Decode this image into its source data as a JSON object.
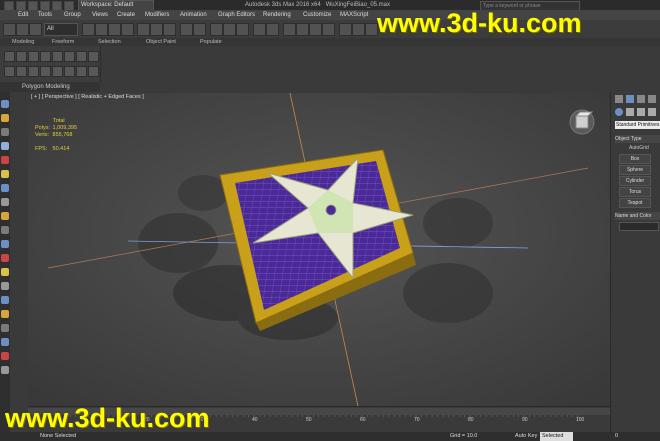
{
  "titlebar": {
    "workspace": "Workspace: Default",
    "app_title": "Autodesk 3ds Max  2016 x64",
    "file_name": "WuXingFeiBiao_05.max",
    "search_placeholder": "Type a keyword or phrase"
  },
  "menu": [
    "Edit",
    "Tools",
    "Group",
    "Views",
    "Create",
    "Modifiers",
    "Animation",
    "Graph Editors",
    "Rendering",
    "Customize",
    "MAXScript"
  ],
  "ribbon": {
    "tabs": [
      "Modeling",
      "Freeform",
      "Selection",
      "Object Paint",
      "Populate"
    ],
    "panel_label": "Polygon Modeling"
  },
  "toolbar": {
    "filter_value": "All"
  },
  "viewport": {
    "label": "[ + ] [ Perspective ] [ Realistic + Edged Faces ]",
    "stats_title": "Total",
    "polys_label": "Polys:",
    "polys_value": "1,009,395",
    "verts_label": "Verts:",
    "verts_value": "855,768",
    "fps_label": "FPS:",
    "fps_value": "50.414"
  },
  "command_panel": {
    "dropdown": "Standard Primitives",
    "rollout_object_type": "Object Type",
    "autogrid": "AutoGrid",
    "buttons": [
      "Box",
      "Sphere",
      "Cylinder",
      "Torus",
      "Teapot"
    ],
    "rollout_name_color": "Name and Color"
  },
  "timeline": {
    "ticks": [
      "0",
      "10",
      "20",
      "30",
      "40",
      "50",
      "60",
      "70",
      "80",
      "90",
      "100"
    ]
  },
  "status": {
    "selection": "None Selected",
    "grid": "Grid = 10.0",
    "autokey": "Auto Key",
    "set_mode": "Selected",
    "frame": "0"
  },
  "watermarks": {
    "top": "www.3d-ku.com",
    "bottom": "www.3d-ku.com"
  },
  "colors": {
    "viewport_bg": "#4a4a4a",
    "stats_yellow": "#e2cf3f",
    "platform_yellow": "#c9a01a",
    "platform_purple": "#4b2a97",
    "shuriken": "#e6e6d2",
    "watermark": "#ffff00"
  },
  "icons": [
    "viewcube-icon",
    "create-icon",
    "modify-icon",
    "undo-icon",
    "redo-icon",
    "select-icon",
    "move-icon",
    "rotate-icon",
    "scale-icon",
    "render-icon"
  ]
}
